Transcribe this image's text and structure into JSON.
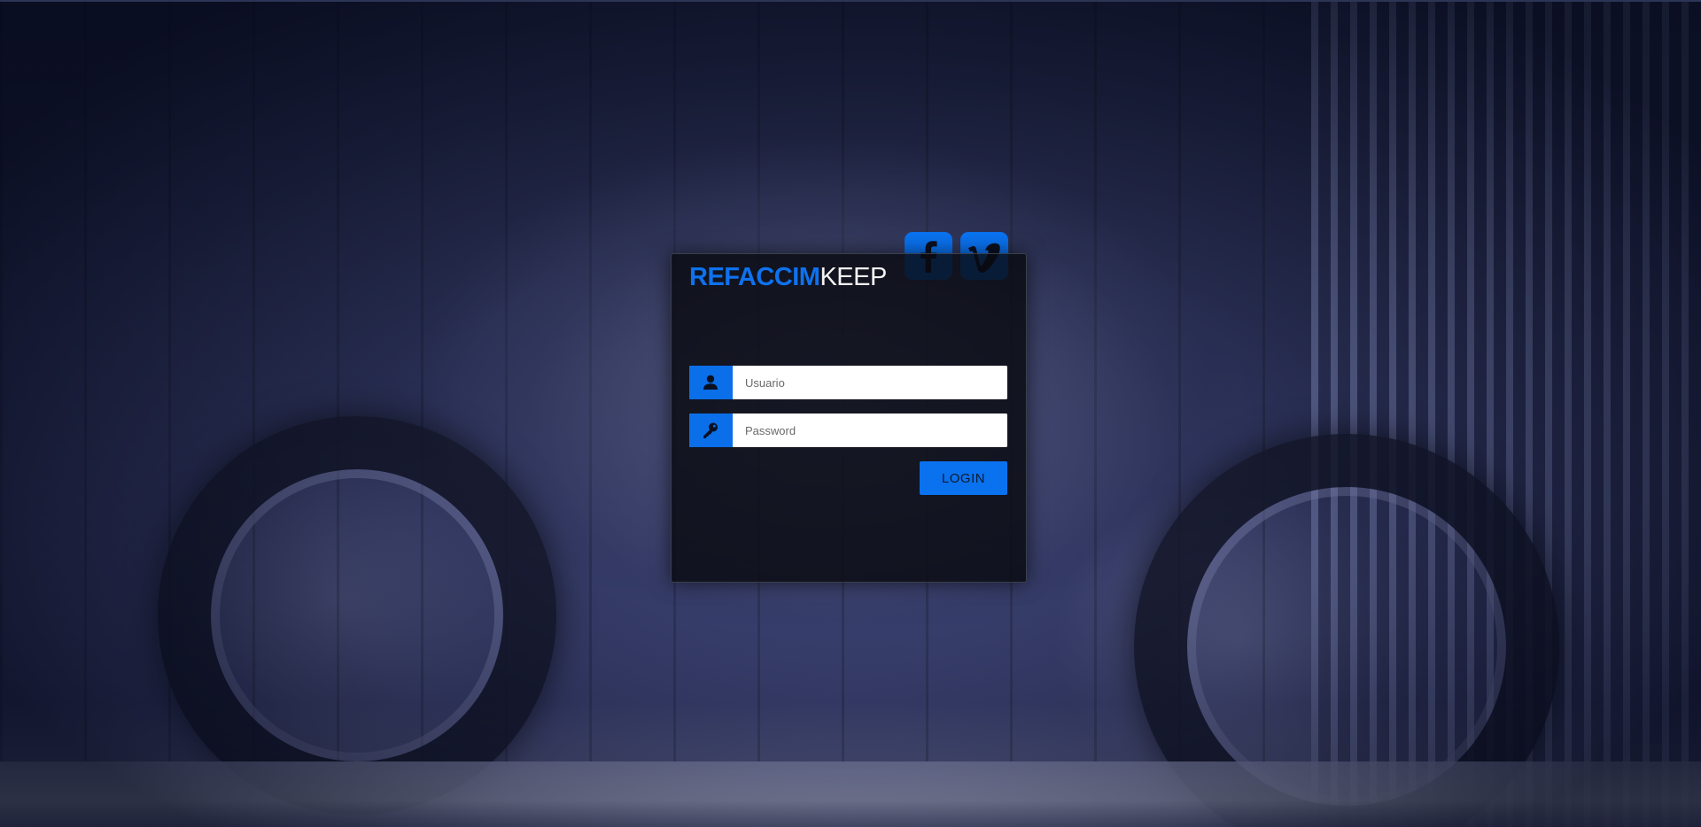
{
  "brand": {
    "part1": "REFACCIM",
    "part2": "KEEP",
    "accent_color": "#0e72ee"
  },
  "social": [
    {
      "name": "facebook",
      "icon": "facebook-icon"
    },
    {
      "name": "vimeo",
      "icon": "vimeo-icon"
    }
  ],
  "form": {
    "username": {
      "placeholder": "Usuario",
      "value": "",
      "icon": "user-icon"
    },
    "password": {
      "placeholder": "Password",
      "value": "",
      "icon": "key-icon"
    },
    "login_label": "LOGIN"
  },
  "colors": {
    "primary": "#0a72ef",
    "panel_bg": "rgba(8,10,16,0.82)"
  }
}
